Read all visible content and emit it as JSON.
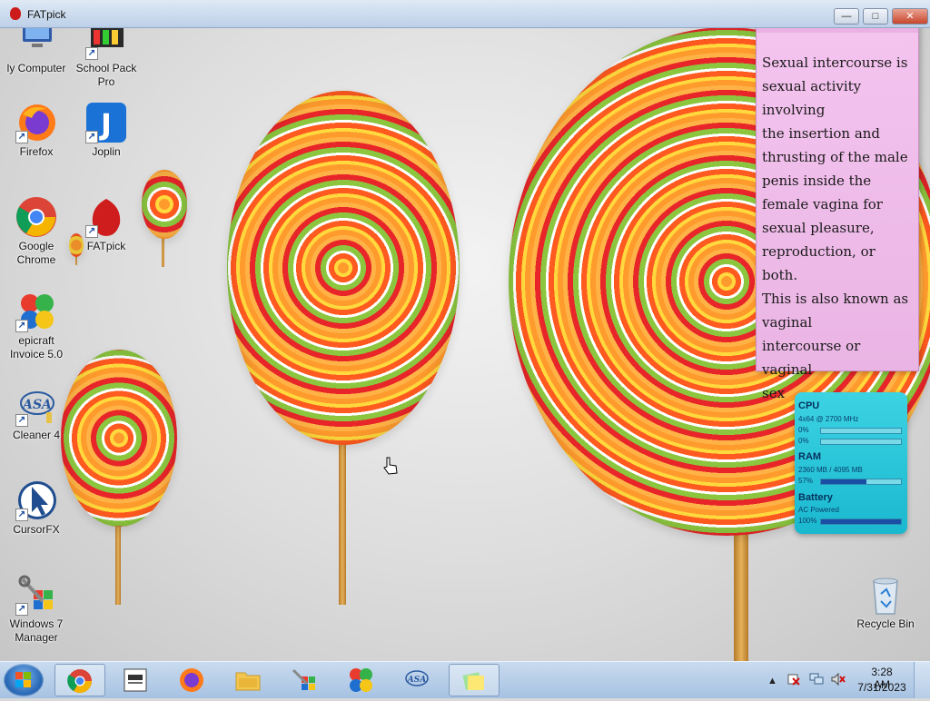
{
  "window": {
    "title": "FATpick",
    "buttons": {
      "minimize": "—",
      "maximize": "□",
      "close": "✕"
    }
  },
  "desktop_icons": [
    {
      "label": "My Computer",
      "label_shown": "ly Computer"
    },
    {
      "label": "School Pack Pro"
    },
    {
      "label": "Firefox"
    },
    {
      "label": "Joplin"
    },
    {
      "label": "Google Chrome"
    },
    {
      "label": "FATpick"
    },
    {
      "label": "epicraft Invoice 5.0"
    },
    {
      "label": "Cleaner 4"
    },
    {
      "label": "CursorFX"
    },
    {
      "label": "Windows 7 Manager"
    },
    {
      "label": "Recycle Bin"
    }
  ],
  "sticky_note": {
    "text": "Sexual intercourse is\nsexual activity\ninvolving\nthe insertion and\nthrusting of the male\npenis inside the\nfemale vagina for\nsexual pleasure,\nreproduction, or both.\nThis is also known as\nvaginal\nintercourse or vaginal\nsex"
  },
  "system_meter": {
    "cpu": {
      "title": "CPU",
      "detail": "4x64 @ 2700 MHz",
      "core1": "0%",
      "core2": "0%",
      "core1_fraction": 0,
      "core2_fraction": 0
    },
    "ram": {
      "title": "RAM",
      "detail": "2360 MB / 4095 MB",
      "usage": "57%",
      "fraction": 0.57
    },
    "battery": {
      "title": "Battery",
      "detail": "AC Powered",
      "level": "100%",
      "fraction": 1.0
    }
  },
  "taskbar": {
    "items": [
      "chrome",
      "school-pack-pro",
      "firefox",
      "file-explorer",
      "windows-7-manager",
      "epicraft-invoice",
      "cleaner",
      "sticky-notes"
    ],
    "clock": {
      "time": "3:28 AM",
      "date": "7/31/2023"
    }
  },
  "colors": {
    "sticky_bg": "#f4c4ef",
    "meter_bg": "#2ccbdc",
    "taskbar_bg": "#b9d0ea",
    "close_button": "#c8452c"
  }
}
